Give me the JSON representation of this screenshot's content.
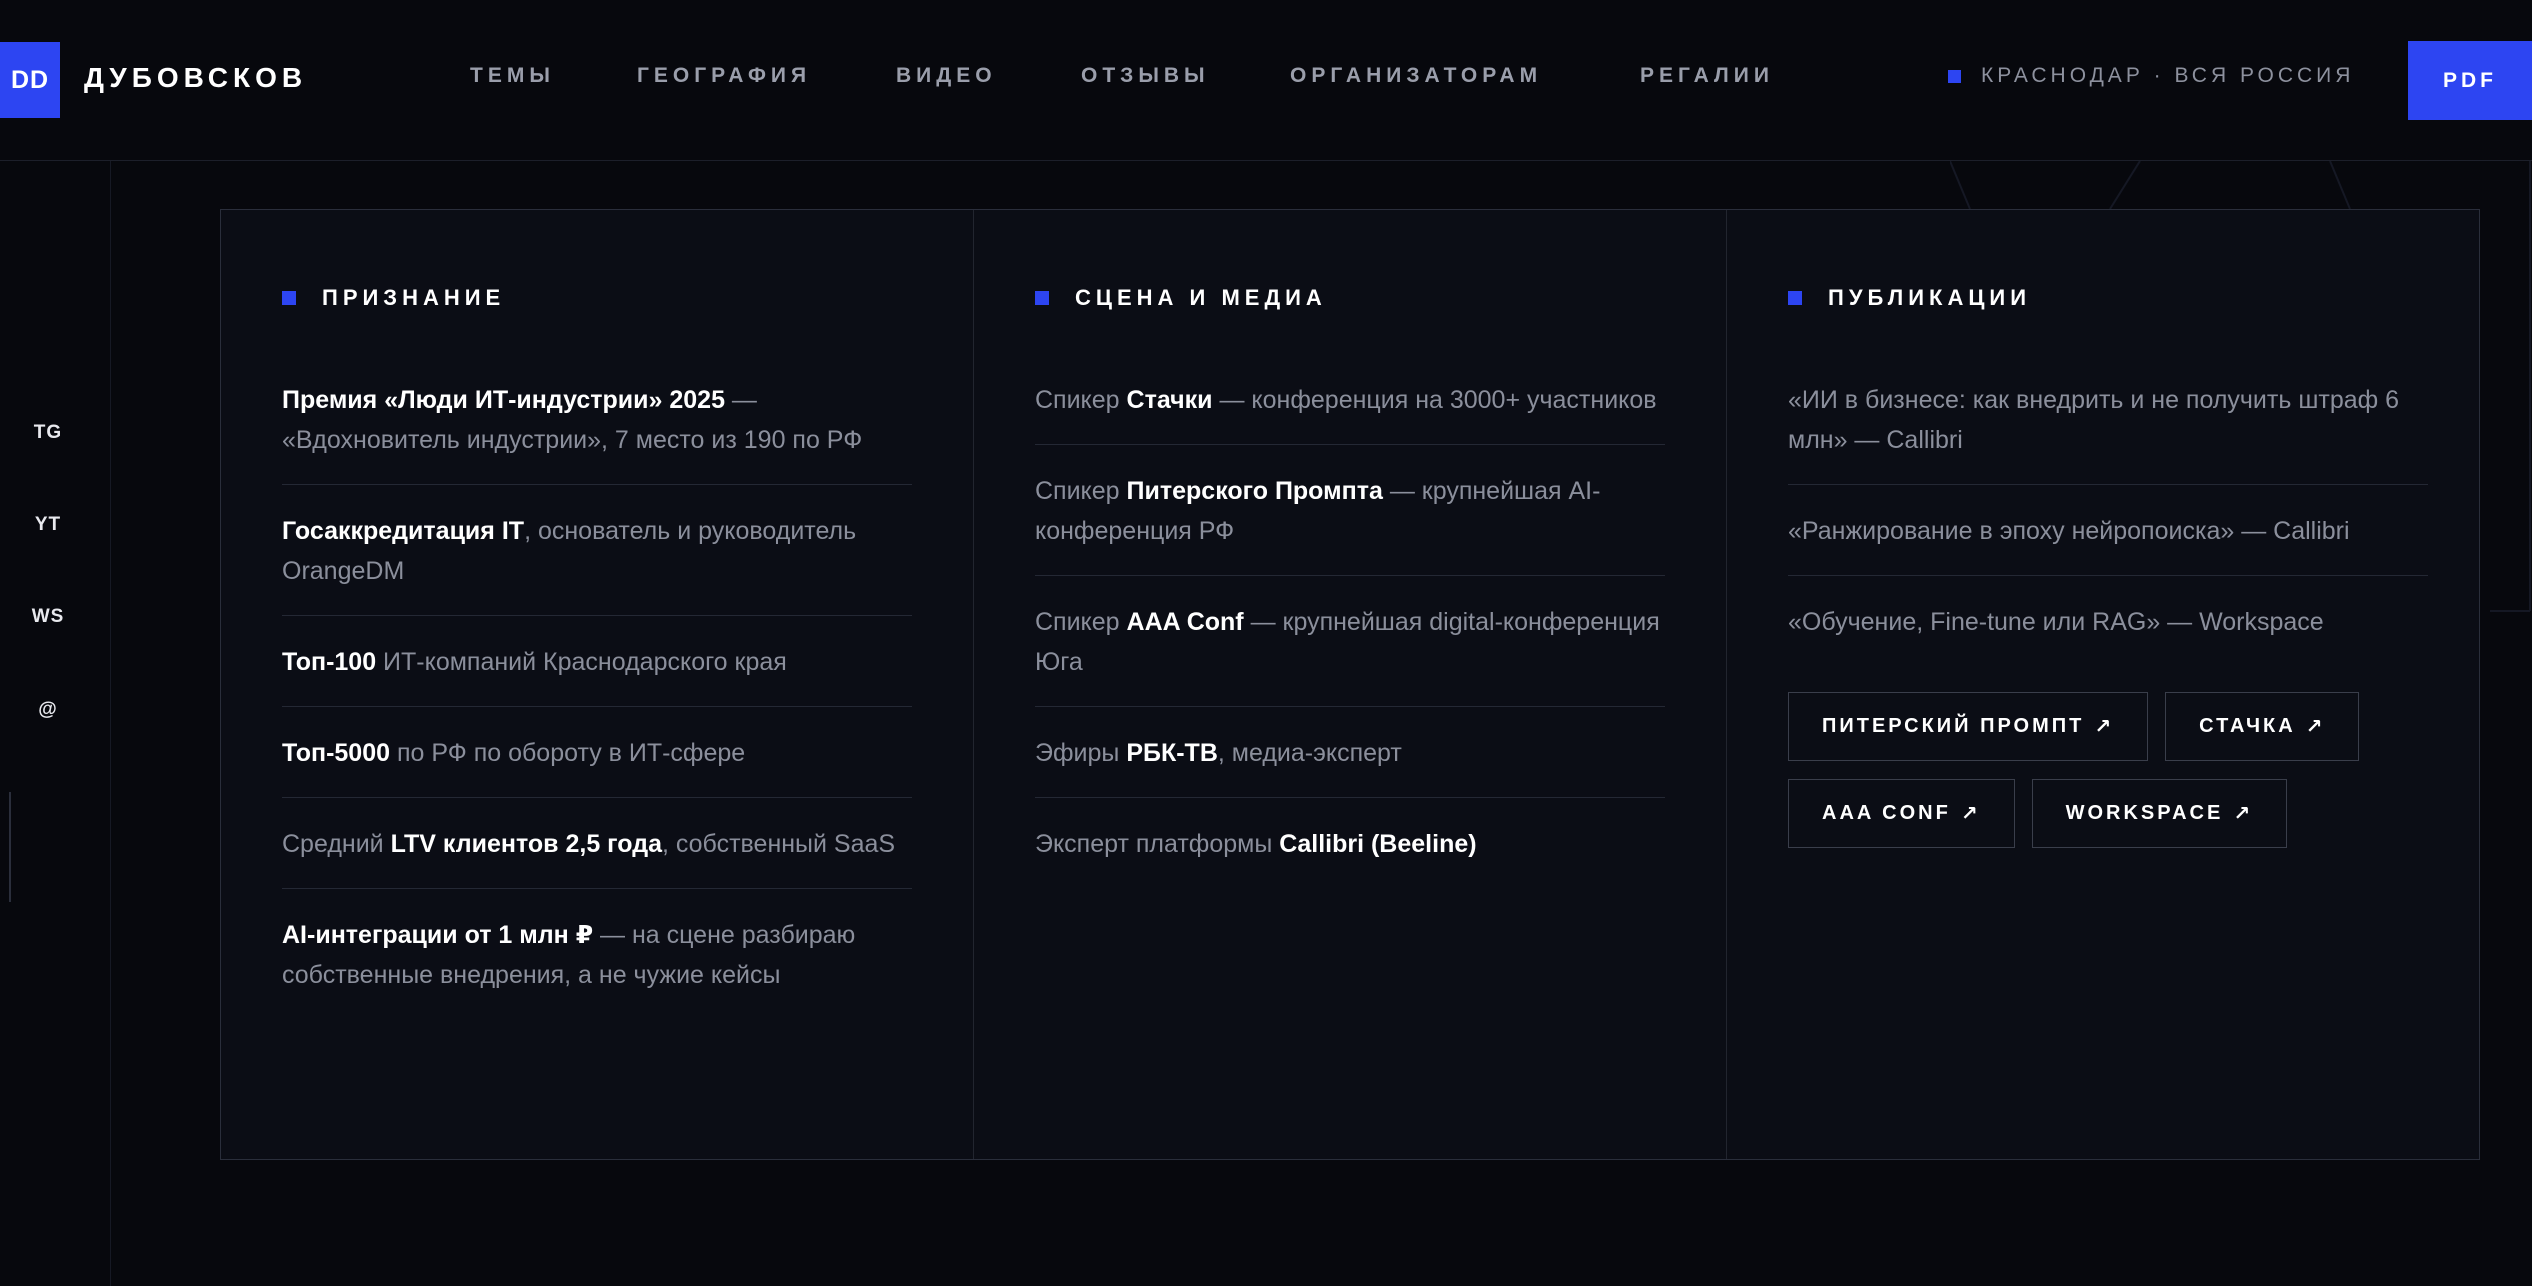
{
  "brand": {
    "mark": "DD",
    "name": "ДУБОВСКОВ"
  },
  "nav": [
    {
      "label": "ТЕМЫ"
    },
    {
      "label": "ГЕОГРАФИЯ"
    },
    {
      "label": "ВИДЕО"
    },
    {
      "label": "ОТЗЫВЫ"
    },
    {
      "label": "ОРГАНИЗАТОРАМ"
    },
    {
      "label": "РЕГАЛИИ"
    }
  ],
  "geo": "КРАСНОДАР · ВСЯ РОССИЯ",
  "pdf_label": "PDF",
  "social": [
    "TG",
    "YT",
    "WS",
    "@"
  ],
  "colors": {
    "accent": "#2d45f2",
    "background": "#07080d",
    "panel": "#0b0d15"
  },
  "columns": [
    {
      "title": "ПРИЗНАНИЕ",
      "entries": [
        {
          "parts": [
            {
              "b": "Премия «Люди ИТ-индустрии» 2025"
            },
            {
              "t": " — «Вдохновитель индустрии», 7 место из 190 по РФ"
            }
          ]
        },
        {
          "parts": [
            {
              "b": "Госаккредитация IT"
            },
            {
              "t": ", основатель и руководитель OrangeDM"
            }
          ]
        },
        {
          "parts": [
            {
              "b": "Топ-100"
            },
            {
              "t": " ИТ-компаний Краснодарского края"
            }
          ]
        },
        {
          "parts": [
            {
              "b": "Топ-5000"
            },
            {
              "t": " по РФ по обороту в ИТ-сфере"
            }
          ]
        },
        {
          "parts": [
            {
              "t": "Средний "
            },
            {
              "b": "LTV клиентов 2,5 года"
            },
            {
              "t": ", собственный SaaS"
            }
          ]
        },
        {
          "parts": [
            {
              "b": "AI-интеграции от 1 млн ₽"
            },
            {
              "t": " — на сцене разбираю собственные внедрения, а не чужие кейсы"
            }
          ]
        }
      ]
    },
    {
      "title": "СЦЕНА И МЕДИА",
      "entries": [
        {
          "parts": [
            {
              "t": "Спикер "
            },
            {
              "b": "Стачки"
            },
            {
              "t": " — конференция на 3000+ участников"
            }
          ]
        },
        {
          "parts": [
            {
              "t": "Спикер "
            },
            {
              "b": "Питерского Промпта"
            },
            {
              "t": " — крупнейшая AI-конференция РФ"
            }
          ]
        },
        {
          "parts": [
            {
              "t": "Спикер "
            },
            {
              "b": "AAA Conf"
            },
            {
              "t": " — крупнейшая digital-конференция Юга"
            }
          ]
        },
        {
          "parts": [
            {
              "t": "Эфиры "
            },
            {
              "b": "РБК-ТВ"
            },
            {
              "t": ", медиа-эксперт"
            }
          ]
        },
        {
          "parts": [
            {
              "t": "Эксперт платформы "
            },
            {
              "b": "Callibri (Beeline)"
            }
          ]
        }
      ]
    },
    {
      "title": "ПУБЛИКАЦИИ",
      "entries": [
        {
          "parts": [
            {
              "t": "«ИИ в бизнесе: как внедрить и не получить штраф 6 млн» — Callibri"
            }
          ]
        },
        {
          "parts": [
            {
              "t": "«Ранжирование в эпоху нейропоиска» — Callibri"
            }
          ]
        },
        {
          "parts": [
            {
              "t": "«Обучение, Fine-tune или RAG» — Workspace"
            }
          ]
        }
      ],
      "buttons": [
        "ПИТЕРСКИЙ ПРОМПТ",
        "СТАЧКА",
        "AAA CONF",
        "WORKSPACE"
      ],
      "button_arrow": "↗"
    }
  ]
}
